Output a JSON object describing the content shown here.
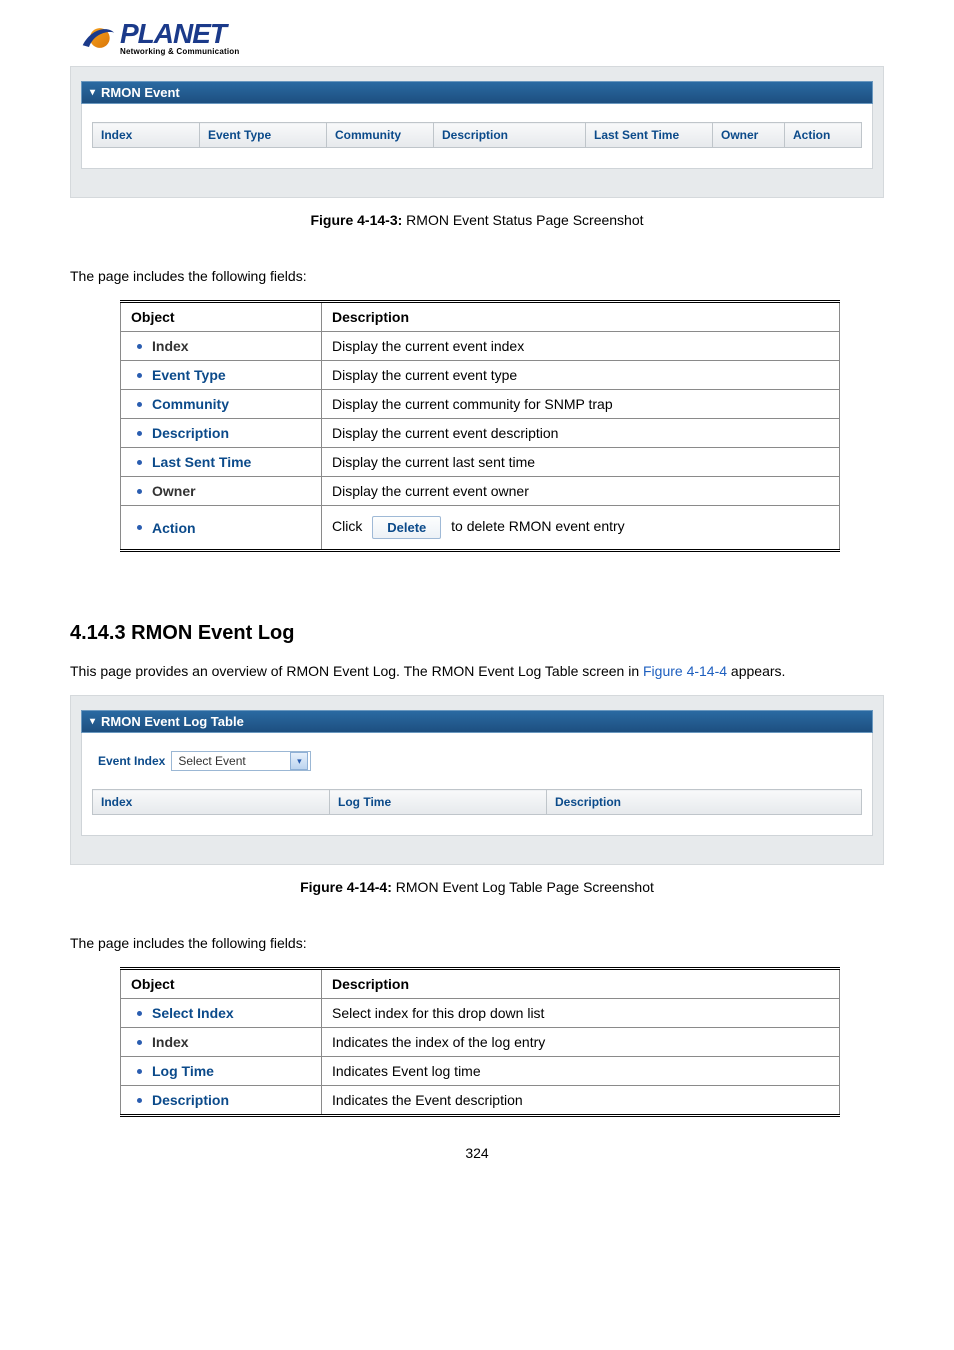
{
  "logo": {
    "title": "PLANET",
    "subtitle": "Networking & Communication"
  },
  "panel1": {
    "title": "RMON Event",
    "columns": [
      "Index",
      "Event Type",
      "Community",
      "Description",
      "Last Sent Time",
      "Owner",
      "Action"
    ]
  },
  "figure1": {
    "label": "Figure 4-14-3:",
    "text": "RMON Event Status Page Screenshot"
  },
  "intro1": "The page includes the following fields:",
  "table1": {
    "head": [
      "Object",
      "Description"
    ],
    "rows": [
      {
        "obj": "Index",
        "desc": "Display the current event index",
        "dark": true
      },
      {
        "obj": "Event Type",
        "desc": "Display the current event type",
        "dark": false
      },
      {
        "obj": "Community",
        "desc": "Display the current community for SNMP trap",
        "dark": false
      },
      {
        "obj": "Description",
        "desc": "Display the current event description",
        "dark": false
      },
      {
        "obj": "Last Sent Time",
        "desc": "Display the current last sent time",
        "dark": false
      },
      {
        "obj": "Owner",
        "desc": "Display the current event owner",
        "dark": true
      },
      {
        "obj": "Action",
        "desc_pre": "Click",
        "btn": "Delete",
        "desc_post": "to delete RMON event entry",
        "dark": false
      }
    ]
  },
  "section": {
    "heading": "4.14.3 RMON Event Log",
    "intro_pre": "This page provides an overview of RMON Event Log. The RMON Event Log Table screen in ",
    "intro_link": "Figure 4-14-4",
    "intro_post": " appears."
  },
  "panel2": {
    "title": "RMON Event Log Table",
    "select_label": "Event Index",
    "select_value": "Select Event",
    "columns": [
      "Index",
      "Log Time",
      "Description"
    ]
  },
  "figure2": {
    "label": "Figure 4-14-4:",
    "text": "RMON Event Log Table Page Screenshot"
  },
  "intro2": "The page includes the following fields:",
  "table2": {
    "head": [
      "Object",
      "Description"
    ],
    "rows": [
      {
        "obj": "Select Index",
        "desc": "Select index for this drop down list",
        "dark": false
      },
      {
        "obj": "Index",
        "desc": "Indicates the index of the log entry",
        "dark": true
      },
      {
        "obj": "Log Time",
        "desc": "Indicates Event log time",
        "dark": false
      },
      {
        "obj": "Description",
        "desc": "Indicates the Event description",
        "dark": false
      }
    ]
  },
  "page_number": "324"
}
